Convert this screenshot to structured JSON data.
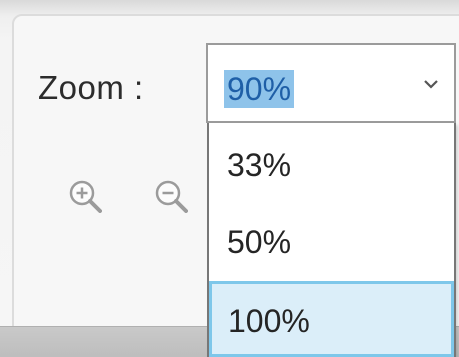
{
  "zoom": {
    "label": "Zoom :",
    "selected_value": "90%",
    "options": [
      "33%",
      "50%",
      "100%"
    ],
    "hovered_option": "100%"
  },
  "toolbar": {
    "icons": [
      "zoom-in-icon",
      "zoom-out-icon"
    ]
  },
  "colors": {
    "selection_highlight": "#8ec3ea",
    "selected_text": "#1f5fa7",
    "hover_background": "#dbeef9",
    "hover_border": "#7ec7ea"
  }
}
